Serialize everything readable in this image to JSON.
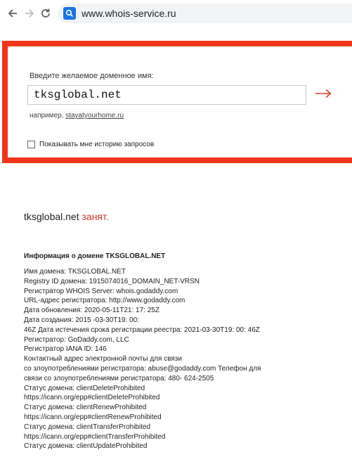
{
  "browser": {
    "url": "www.whois-service.ru"
  },
  "search": {
    "prompt": "Введите желаемое доменное имя:",
    "value": "tksglobal.net",
    "example_prefix": "например,",
    "example_link": "stayatyourhome.ru",
    "history_label": "Показывать мне историю запросов",
    "history_checked": false
  },
  "result": {
    "domain": "tksglobal.net",
    "status": "занят."
  },
  "info": {
    "heading": "Информация о домене TKSGLOBAL.NET",
    "lines": [
      "Имя домена: TKSGLOBAL.NET",
      "Registry ID домена: 1915074016_DOMAIN_NET-VRSN",
      "Регистратор WHOIS Server: whois.godaddy.com",
      "URL-адрес регистратора: http://www.godaddy.com",
      "Дата обновления: 2020-05-11T21: 17: 25Z",
      "Дата создания: 2015 -03-30T19: 00:",
      "46Z Дата истечения срока регистрации реестра: 2021-03-30T19: 00: 46Z",
      "Регистратор: GoDaddy.com, LLC",
      "Регистратор IANA ID: 146",
      "Контактный адрес электронной почты для связи",
      "со злоупотреблениями регистратора: abuse@godaddy.com Телефон для",
      "связи со злоупотреблениями регистратора: 480- 624-2505",
      "Статус домена: clientDeleteProhibited",
      "https://icann.org/epp#clientDeleteProhibited",
      "Статус домена: clientRenewProhibited",
      "https://icann.org/epp#clientRenewProhibited",
      "Статус домена: clientTransferProhibited",
      "https://icann.org/epp#clientTransferProhibited",
      "Статус домена: clientUpdateProhibited"
    ]
  },
  "colors": {
    "panel_border": "#f0351a",
    "arrow": "#e0402a",
    "taken": "#c0392b"
  },
  "icons": [
    "back-arrow-icon",
    "forward-arrow-icon",
    "reload-icon",
    "site-search-icon",
    "submit-arrow-icon"
  ]
}
